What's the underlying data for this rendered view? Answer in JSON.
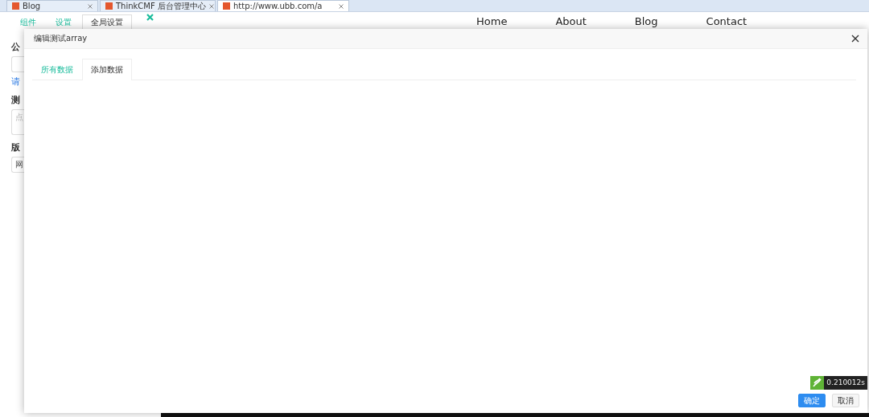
{
  "browser_tabs": [
    {
      "title": "Blog",
      "selected": false
    },
    {
      "title": "ThinkCMF 后台管理中心",
      "selected": false
    },
    {
      "title": "http://www.ubb.com/a",
      "selected": true
    }
  ],
  "background_page": {
    "tabs": [
      {
        "label": "组件",
        "selected": false
      },
      {
        "label": "设置",
        "selected": false
      },
      {
        "label": "全局设置",
        "selected": true
      }
    ],
    "fields": [
      {
        "label": "公",
        "kind": "input",
        "help": "请"
      },
      {
        "label": "测",
        "kind": "textarea",
        "placeholder": "点"
      },
      {
        "label": "版",
        "kind": "input",
        "value": "网"
      }
    ],
    "nav": [
      "Home",
      "About",
      "Blog",
      "Contact"
    ]
  },
  "modal": {
    "title": "编辑测试array",
    "tabs": [
      {
        "label": "所有数据",
        "selected": false
      },
      {
        "label": "添加数据",
        "selected": true
      }
    ],
    "buttons": [
      {
        "label": "确定",
        "kind": "primary"
      },
      {
        "label": "取消",
        "kind": "default"
      }
    ]
  },
  "debug": {
    "time": "0.210012s"
  }
}
